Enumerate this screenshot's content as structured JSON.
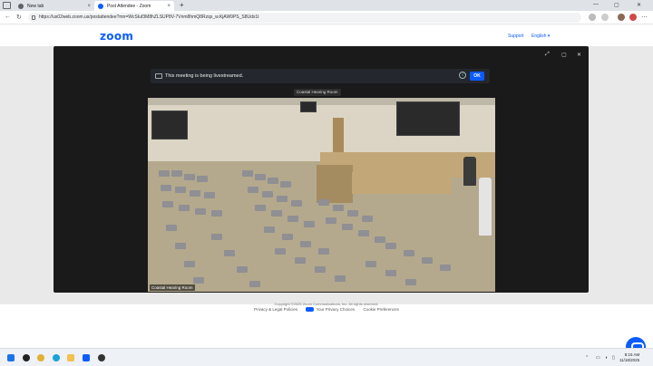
{
  "browser": {
    "tabs": [
      {
        "title": "New tab",
        "favicon_color": "#5f6368"
      },
      {
        "title": "Post Attendee - Zoom",
        "favicon_color": "#0b5cff"
      }
    ],
    "url": "https://us02web.zoom.us/postattendee?mn=WcSIuf3M8hZLSUP8V-7Vnm8hmQ8Rzqx_w.KjAW9PS_S8Udx1t",
    "new_tab_symbol": "+",
    "close_symbol": "×"
  },
  "zoom_header": {
    "logo": "zoom",
    "support": "Support",
    "language": "English ▾"
  },
  "meeting": {
    "banner_message": "This meeting is being livestreamed.",
    "ok_label": "OK",
    "info_symbol": "i",
    "participant_name": "Coastal Hearing Room",
    "video_label": "Coastal Hearing Room"
  },
  "footer": {
    "copyright": "Copyright ©2025 Zoom Communications, Inc. All rights reserved.",
    "privacy": "Privacy & Legal Policies",
    "your_privacy": "Your Privacy Choices",
    "cookie": "Cookie Preferences"
  },
  "taskbar": {
    "time": "8:15 AM",
    "date": "11/18/2025"
  },
  "colors": {
    "zoom_blue": "#0b5cff",
    "modal_bg": "#1a1a1a"
  }
}
